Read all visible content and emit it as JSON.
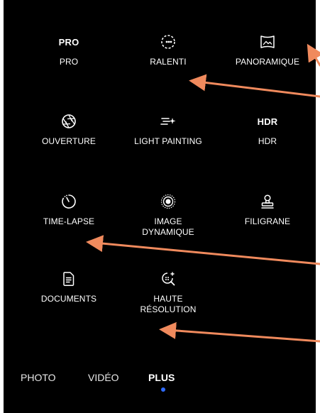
{
  "modes": {
    "items": [
      {
        "label": "PRO",
        "icon_text": "PRO",
        "icon": "pro-text-icon"
      },
      {
        "label": "RALENTI",
        "icon": "slow-motion-icon"
      },
      {
        "label": "PANORAMIQUE",
        "icon": "panorama-icon"
      },
      {
        "label": "OUVERTURE",
        "icon": "aperture-icon"
      },
      {
        "label": "LIGHT PAINTING",
        "icon": "light-painting-icon"
      },
      {
        "label": "HDR",
        "icon_text": "HDR",
        "icon": "hdr-text-icon"
      },
      {
        "label": "TIME-LAPSE",
        "icon": "timelapse-icon"
      },
      {
        "label": "IMAGE\nDYNAMIQUE",
        "icon": "moving-picture-icon"
      },
      {
        "label": "FILIGRANE",
        "icon": "watermark-stamp-icon"
      },
      {
        "label": "DOCUMENTS",
        "icon": "document-icon"
      },
      {
        "label": "HAUTE\nRÉSOLUTION",
        "icon": "high-resolution-icon"
      }
    ]
  },
  "mode_bar": {
    "items": [
      "PHOTO",
      "VIDÉO",
      "PLUS"
    ],
    "active": "PLUS"
  },
  "colors": {
    "background": "#000000",
    "text": "#ffffff",
    "active_indicator": "#2f6bff",
    "annotation_arrow": "#f08a5d"
  }
}
